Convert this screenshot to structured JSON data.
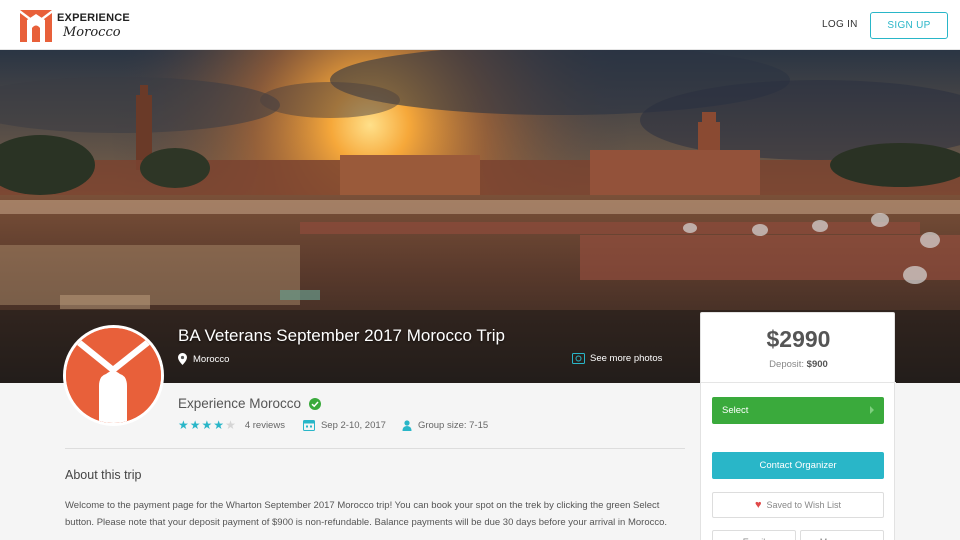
{
  "header": {
    "logo_line1": "EXPERIENCE",
    "logo_line2": "Morocco",
    "login_label": "LOG IN",
    "signup_label": "SIGN UP"
  },
  "trip": {
    "title": "BA Veterans September 2017 Morocco Trip",
    "location": "Morocco",
    "photos_label": "See more photos"
  },
  "organizer": {
    "name": "Experience Morocco",
    "rating_stars": 4,
    "max_stars": 5,
    "reviews": "4 reviews",
    "dates": "Sep 2-10, 2017",
    "group_size": "Group size: 7-15"
  },
  "about": {
    "heading": "About this trip",
    "text": "Welcome to the payment page for the Wharton September 2017 Morocco trip! You can book your spot on the trek by clicking the green Select button. Please note that your deposit payment of $900 is non-refundable. Balance payments will be due 30 days before your arrival in Morocco."
  },
  "pricing": {
    "price": "$2990",
    "deposit_label": "Deposit: ",
    "deposit_value": "$900",
    "select_label": "Select",
    "contact_label": "Contact Organizer",
    "wishlist_label": "Saved to Wish List",
    "share_email": "Email",
    "share_messenger": "Messenger"
  },
  "colors": {
    "accent": "#29b6c8",
    "select_green": "#3aaa3c",
    "brand_orange": "#e8603a",
    "star": "#29b6c8"
  },
  "icons": [
    "location-pin-icon",
    "camera-icon",
    "verified-check-icon",
    "star-icon",
    "calendar-icon",
    "person-icon",
    "heart-icon"
  ]
}
